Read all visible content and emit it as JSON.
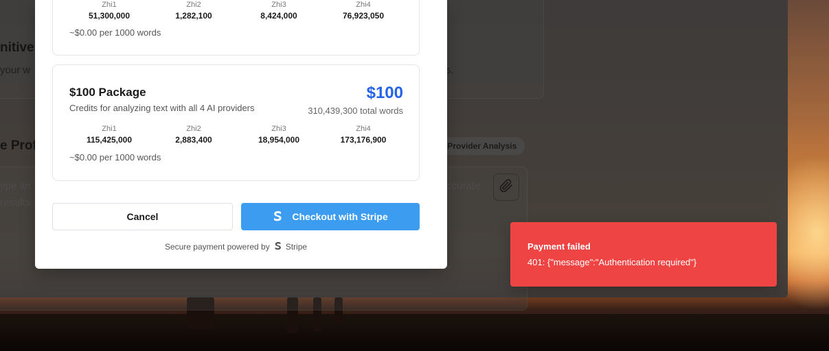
{
  "background_app": {
    "heading_1": "nitive",
    "text_1_left": "your w",
    "text_1_right": "s.",
    "heading_2": "e Profi",
    "chip_label": "ti-Provider Analysis",
    "placeholder_left": "ype an",
    "placeholder_right": "ccurate",
    "results_text": "results.",
    "attach_icon": "paperclip-icon"
  },
  "modal": {
    "packages": [
      {
        "providers": [
          {
            "name": "Zhi1",
            "value": "51,300,000"
          },
          {
            "name": "Zhi2",
            "value": "1,282,100"
          },
          {
            "name": "Zhi3",
            "value": "8,424,000"
          },
          {
            "name": "Zhi4",
            "value": "76,923,050"
          }
        ],
        "per_words": "~$0.00 per 1000 words"
      },
      {
        "name": "$100 Package",
        "description": "Credits for analyzing text with all 4 AI providers",
        "price": "$100",
        "total_words": "310,439,300 total words",
        "providers": [
          {
            "name": "Zhi1",
            "value": "115,425,000"
          },
          {
            "name": "Zhi2",
            "value": "2,883,400"
          },
          {
            "name": "Zhi3",
            "value": "18,954,000"
          },
          {
            "name": "Zhi4",
            "value": "173,176,900"
          }
        ],
        "per_words": "~$0.00 per 1000 words"
      }
    ],
    "cancel_label": "Cancel",
    "checkout_label": "Checkout with Stripe",
    "checkout_icon": "stripe-s-icon",
    "secure_text": "Secure payment powered by",
    "secure_brand": "Stripe"
  },
  "toast": {
    "title": "Payment failed",
    "message": "401: {\"message\":\"Authentication required\"}",
    "color": "#ef4444"
  },
  "colors": {
    "accent": "#2563eb",
    "stripe_button": "#3b9cf0"
  }
}
